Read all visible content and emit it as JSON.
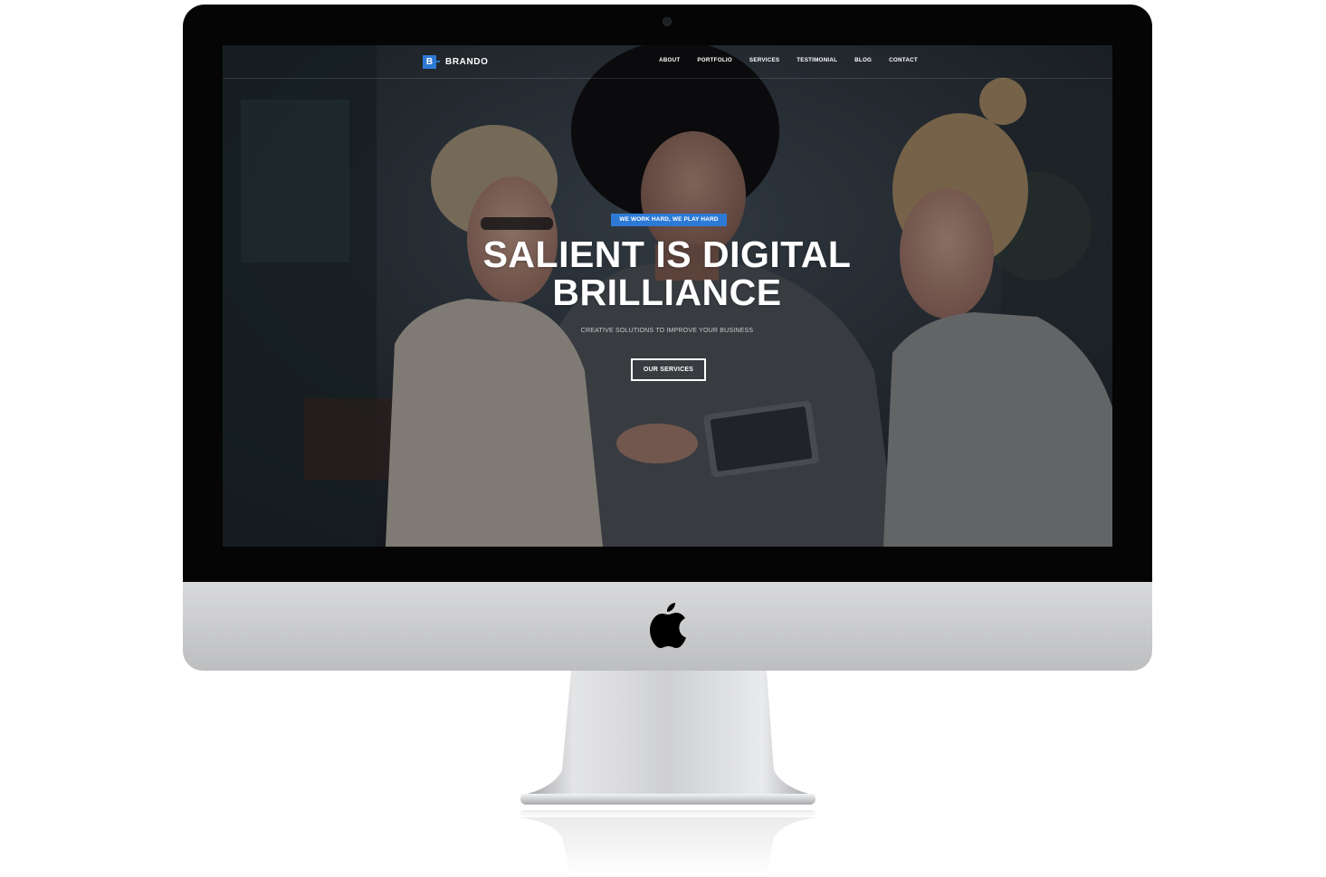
{
  "site": {
    "brand_mark": "B",
    "brand_name": "BRANDO"
  },
  "nav": {
    "items": [
      {
        "label": "ABOUT"
      },
      {
        "label": "PORTFOLIO"
      },
      {
        "label": "SERVICES"
      },
      {
        "label": "TESTIMONIAL"
      },
      {
        "label": "BLOG"
      },
      {
        "label": "CONTACT"
      }
    ]
  },
  "hero": {
    "badge": "WE WORK HARD, WE PLAY HARD",
    "title_line1": "SALIENT IS DIGITAL",
    "title_line2": "BRILLIANCE",
    "subtitle": "CREATIVE SOLUTIONS TO IMPROVE YOUR BUSINESS",
    "cta": "OUR SERVICES"
  },
  "colors": {
    "accent": "#2d7ad6",
    "bezel": "#050505",
    "chin": "#c9cacc"
  },
  "icons": {
    "device_logo": "apple-logo-icon"
  }
}
